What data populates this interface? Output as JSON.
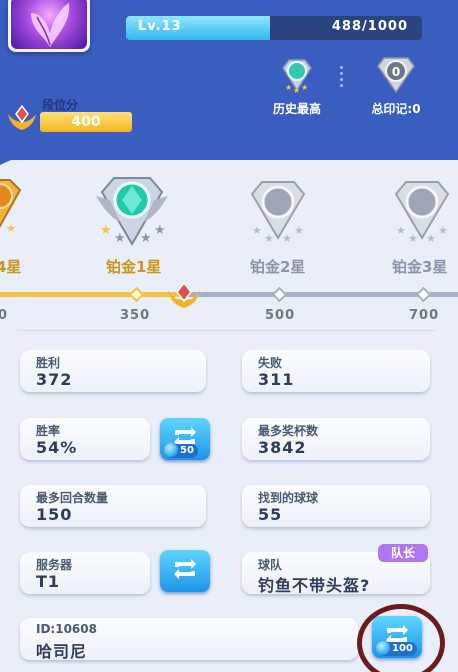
{
  "header": {
    "level_label": "Lv.13",
    "xp_text": "488/1000",
    "xp_fraction": 0.488
  },
  "rank": {
    "history_best_label": "历史最高",
    "total_seals_label": "总印记:0",
    "total_seals_badge": "0"
  },
  "points": {
    "label": "段位分",
    "value": "400"
  },
  "tiers": [
    {
      "name": "4星",
      "tick": "0"
    },
    {
      "name": "铂金1星",
      "tick": "350"
    },
    {
      "name": "铂金2星",
      "tick": "500"
    },
    {
      "name": "铂金3星",
      "tick": "700"
    }
  ],
  "stats": [
    {
      "key": "胜利",
      "value": "372"
    },
    {
      "key": "失败",
      "value": "311"
    },
    {
      "key": "胜率",
      "value": "54%"
    },
    {
      "key": "最多奖杯数",
      "value": "3842"
    },
    {
      "key": "最多回合数量",
      "value": "150"
    },
    {
      "key": "找到的球球",
      "value": "55"
    },
    {
      "key": "服务器",
      "value": "T1"
    },
    {
      "key": "球队",
      "value": "钓鱼不带头盔?"
    }
  ],
  "team_badge": "队长",
  "id_card": {
    "key": "ID:10608",
    "value": "哈司尼"
  },
  "buttons": {
    "refresh_winrate_cost": "50",
    "refresh_id_cost": "100"
  },
  "colors": {
    "header_blue": "#3a5dc0",
    "gold": "#f0c43c",
    "button_blue": "#1d94e8",
    "badge_purple": "#b177ee",
    "highlight_circle": "#6b1a1e"
  }
}
